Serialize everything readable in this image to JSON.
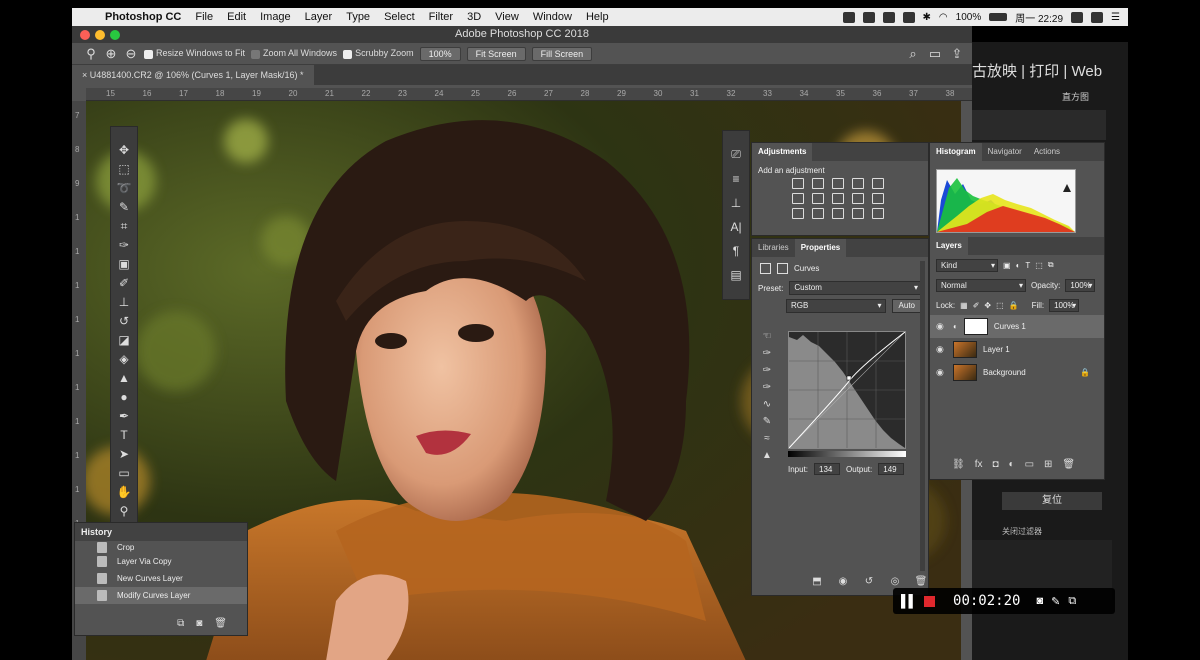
{
  "menubar": {
    "app_name": "Photoshop CC",
    "items": [
      "File",
      "Edit",
      "Image",
      "Layer",
      "Type",
      "Select",
      "Filter",
      "3D",
      "View",
      "Window",
      "Help"
    ],
    "battery": "100%",
    "clock": "周一 22:29"
  },
  "window": {
    "title": "Adobe Photoshop CC 2018",
    "document_tab": "U4881400.CR2 @ 106% (Curves 1, Layer Mask/16) *"
  },
  "options_bar": {
    "resize_windows": "Resize Windows to Fit",
    "zoom_all": "Zoom All Windows",
    "scrubby_zoom": "Scrubby Zoom",
    "zoom_value": "100%",
    "fit_screen": "Fit Screen",
    "fill_screen": "Fill Screen"
  },
  "ruler": {
    "h_ticks": [
      "15",
      "16",
      "17",
      "18",
      "19",
      "20",
      "21",
      "22",
      "23",
      "24",
      "25",
      "26",
      "27",
      "28",
      "29",
      "30",
      "31",
      "32",
      "33",
      "34",
      "35",
      "36",
      "37",
      "38"
    ],
    "v_ticks": [
      "7",
      "8",
      "9",
      "1",
      "1",
      "1",
      "1",
      "1",
      "1",
      "1",
      "1",
      "1",
      "1",
      "1",
      "1",
      "1"
    ]
  },
  "history": {
    "title": "History",
    "items": [
      {
        "label": "Crop",
        "selected": false
      },
      {
        "label": "Layer Via Copy",
        "selected": false
      },
      {
        "label": "New Curves Layer",
        "selected": false
      },
      {
        "label": "Modify Curves Layer",
        "selected": true
      }
    ]
  },
  "adjustments": {
    "tab": "Adjustments",
    "add_label": "Add an adjustment"
  },
  "properties": {
    "tabs": [
      "Libraries",
      "Properties"
    ],
    "title": "Curves",
    "preset_label": "Preset:",
    "preset_value": "Custom",
    "channel": "RGB",
    "auto": "Auto",
    "input_label": "Input:",
    "input_value": "134",
    "output_label": "Output:",
    "output_value": "149"
  },
  "right_panel": {
    "tabs": [
      "Histogram",
      "Navigator",
      "Actions"
    ],
    "layers_tab": "Layers",
    "kind": "Kind",
    "blend_mode": "Normal",
    "opacity_label": "Opacity:",
    "opacity_value": "100%",
    "lock_label": "Lock:",
    "fill_label": "Fill:",
    "fill_value": "100%",
    "layers": [
      {
        "name": "Curves 1",
        "selected": true
      },
      {
        "name": "Layer 1",
        "selected": false
      },
      {
        "name": "Background",
        "selected": false
      }
    ]
  },
  "background_app": {
    "tabs_text": "古放映 | 打印 | Web",
    "histogram_label": "直方图",
    "reset_label": "复位",
    "filter_label": "关闭过滤器"
  },
  "recorder": {
    "time": "00:02:20"
  }
}
